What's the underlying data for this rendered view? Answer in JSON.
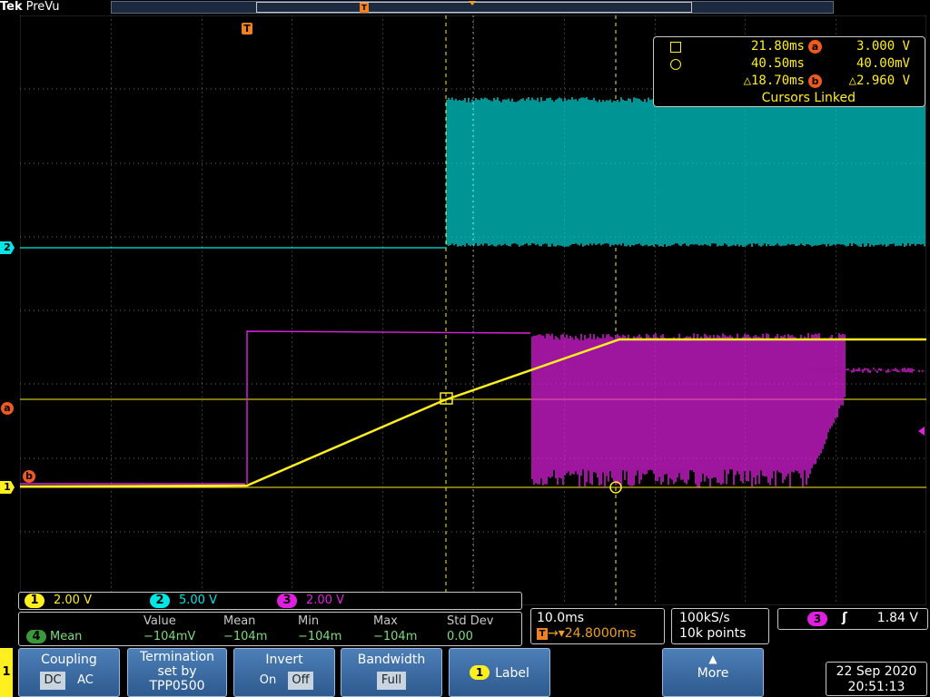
{
  "app": {
    "brand": "Tek",
    "mode": "PreVu"
  },
  "record": {
    "trigger_glyph": "T"
  },
  "markers": {
    "trigger_position": "T",
    "ch2": "2",
    "cursor_a": "a",
    "cursor_b": "b",
    "ch1": "1"
  },
  "cursor_readout": {
    "t1": "21.80ms",
    "a_badge": "a",
    "v_a": "3.000 V",
    "t2": "40.50ms",
    "v_b": "40.00mV",
    "dt": "△18.70ms",
    "b_badge": "b",
    "dv": "△2.960 V",
    "linked": "Cursors Linked"
  },
  "channels": [
    {
      "num": "1",
      "scale": "2.00 V",
      "color": "#ffee20"
    },
    {
      "num": "2",
      "scale": "5.00 V",
      "color": "#00e5e5"
    },
    {
      "num": "3",
      "scale": "2.00 V",
      "color": "#e020e0"
    }
  ],
  "measurement": {
    "source_num": "4",
    "name": "Mean",
    "headers": [
      "Value",
      "Mean",
      "Min",
      "Max",
      "Std Dev"
    ],
    "values": [
      "−104mV",
      "−104m",
      "−104m",
      "−104m",
      "0.00"
    ]
  },
  "horizontal": {
    "scale": "10.0ms",
    "trigger_glyph": "T",
    "delay": "→▾24.8000ms"
  },
  "acquisition": {
    "rate": "100kS/s",
    "length": "10k points"
  },
  "trigger": {
    "source": "3",
    "edge": "ʃ",
    "level": "1.84 V"
  },
  "menu": {
    "channel_tab": "1",
    "coupling": {
      "label": "Coupling",
      "dc": "DC",
      "ac": "AC",
      "selected": "DC"
    },
    "termination": {
      "label": "Termination",
      "line2": "set by",
      "line3": "TPP0500"
    },
    "invert": {
      "label": "Invert",
      "on": "On",
      "off": "Off",
      "selected": "Off"
    },
    "bandwidth": {
      "label": "Bandwidth",
      "value": "Full"
    },
    "label_btn": {
      "num": "1",
      "label": "Label"
    },
    "more": {
      "arrow": "▲",
      "label": "More"
    }
  },
  "datetime": {
    "date": "22 Sep  2020",
    "time": "20:51:13"
  },
  "colors": {
    "ch1": "#ffee20",
    "ch2": "#00e5e5",
    "ch3": "#e020e0",
    "cursor": "#f05a20",
    "trigger": "#f08020",
    "menu_blue": "#3c6aa0"
  }
}
